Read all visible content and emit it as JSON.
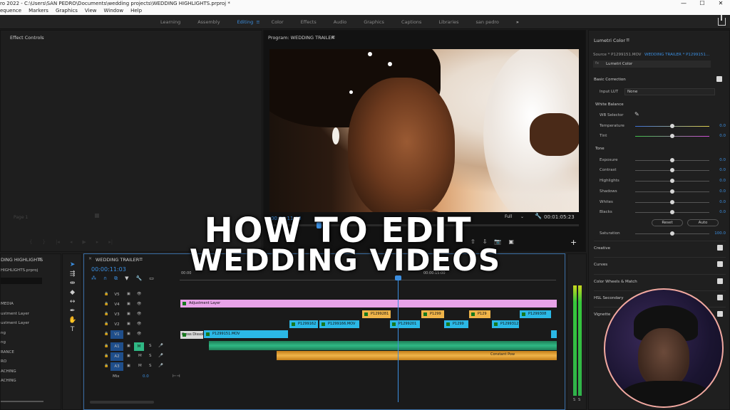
{
  "titlebar": {
    "title": "ro 2022 - C:\\Users\\SAN PEDRO\\Documents\\wedding projects\\WEDDING HIGHLIGHTS.prproj *",
    "minimize": "—",
    "maximize": "☐",
    "close": "✕"
  },
  "menubar": [
    "equence",
    "Markers",
    "Graphics",
    "View",
    "Window",
    "Help"
  ],
  "workspaces": {
    "tabs": [
      "Learning",
      "Assembly",
      "Editing",
      "Color",
      "Effects",
      "Audio",
      "Graphics",
      "Captions",
      "Libraries",
      "san pedro"
    ],
    "active": "Editing",
    "more": "»"
  },
  "effects_panel": {
    "title": "Effect Controls",
    "page": "Page 1"
  },
  "program_panel": {
    "title": "Program: WEDDING TRAILER",
    "menu_icon": "≡",
    "timecode_left": "00:00:11:03",
    "zoom": "Full",
    "timecode_right": "00:01:05:23"
  },
  "lumetri": {
    "title": "Lumetri Color",
    "source": "Source * P1299151.MOV",
    "sequence": "WEDDING TRAILER * P1299151...",
    "fx_name": "Lumetri Color",
    "basic_correction": "Basic Correction",
    "input_lut_label": "Input LUT",
    "input_lut_value": "None",
    "white_balance": "White Balance",
    "wb_selector": "WB Selector",
    "tone": "Tone",
    "sliders": [
      {
        "label": "Temperature",
        "value": "0.0",
        "level": 0.5
      },
      {
        "label": "Tint",
        "value": "0.0",
        "level": 0.5
      },
      {
        "label": "Exposure",
        "value": "0.0",
        "level": 0.5
      },
      {
        "label": "Contrast",
        "value": "0.0",
        "level": 0.5
      },
      {
        "label": "Highlights",
        "value": "0.0",
        "level": 0.5
      },
      {
        "label": "Shadows",
        "value": "0.0",
        "level": 0.5
      },
      {
        "label": "Whites",
        "value": "0.0",
        "level": 0.5
      },
      {
        "label": "Blacks",
        "value": "0.0",
        "level": 0.5
      }
    ],
    "reset": "Reset",
    "auto": "Auto",
    "saturation": {
      "label": "Saturation",
      "value": "100.0",
      "level": 0.5
    },
    "sections": [
      "Creative",
      "Curves",
      "Color Wheels & Match",
      "HSL Secondary",
      "Vignette"
    ]
  },
  "project_panel": {
    "title": "DING HIGHLIGHTS",
    "file": "HIGHLIGHTS.prproj",
    "items": [
      "MEDIA",
      "ustment Layer",
      "ustment Layer",
      "ng",
      "ng",
      "RANCE",
      "RO",
      "ACHING",
      "ACHING"
    ]
  },
  "timeline": {
    "title": "WEDDING TRAILER",
    "timecode": "00:00:11:03",
    "ruler": [
      "00:00",
      "00:00:15:00"
    ],
    "video_tracks": [
      "V5",
      "V4",
      "V3",
      "V2",
      "V1"
    ],
    "audio_tracks": [
      "A1",
      "A2",
      "A3"
    ],
    "mix_label": "Mix",
    "mix_value": "0.0",
    "clips": [
      {
        "label": "Adjustment Layer",
        "track": "V4",
        "color": "#e8a3e8"
      },
      {
        "label": "P1299281",
        "track": "V3",
        "color": "#f0b449"
      },
      {
        "label": "P1299",
        "track": "V3",
        "color": "#f0b449"
      },
      {
        "label": "P129",
        "track": "V3",
        "color": "#f0b449"
      },
      {
        "label": "P1299308",
        "track": "V3",
        "color": "#2bb8e6"
      },
      {
        "label": "P1299162",
        "track": "V2",
        "color": "#2bb8e6"
      },
      {
        "label": "P1299166.MOV",
        "track": "V2",
        "color": "#2bb8e6"
      },
      {
        "label": "P1299201",
        "track": "V2",
        "color": "#2bb8e6"
      },
      {
        "label": "P1299",
        "track": "V2",
        "color": "#2bb8e6"
      },
      {
        "label": "P1299312",
        "track": "V2",
        "color": "#2bb8e6"
      },
      {
        "label": "Cross Dissolve",
        "track": "V1",
        "color": "#d9d9d9"
      },
      {
        "label": "P1299151.MOV",
        "track": "V1",
        "color": "#2bb8e6"
      }
    ],
    "audio_clip": "Constant Pow"
  },
  "meter": {
    "labels": [
      "S",
      "S"
    ]
  },
  "overlay": {
    "line1": "HOW TO EDIT",
    "line2": "WEDDING VIDEOS"
  },
  "colors": {
    "accent": "#3b8ee0",
    "pink": "#e8a3e8",
    "orange": "#f0b449",
    "cyan": "#2bb8e6",
    "green": "#2fb884"
  }
}
